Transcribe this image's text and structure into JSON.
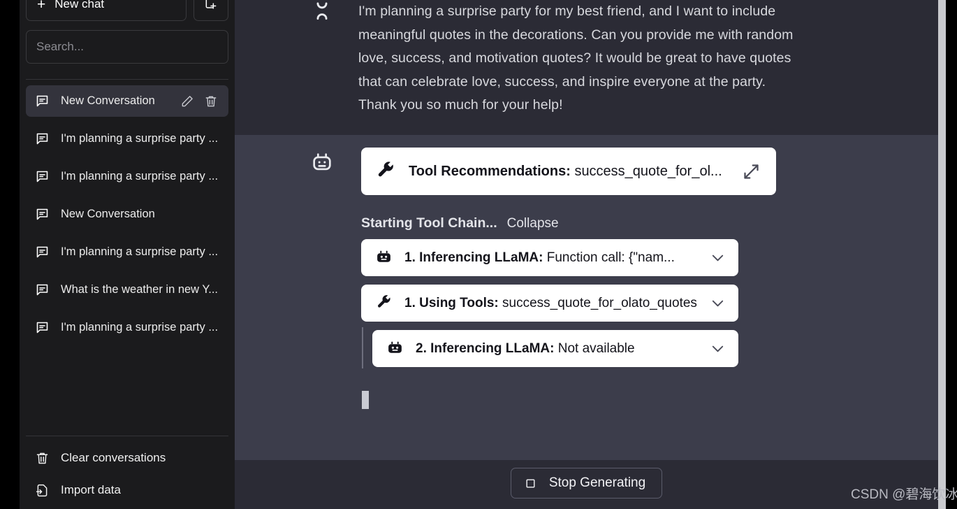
{
  "sidebar": {
    "new_chat_label": "New chat",
    "new_folder_icon": "new-folder-icon",
    "search_placeholder": "Search...",
    "search_value": "",
    "conversations": [
      {
        "label": "New Conversation",
        "icon": "chat-bubble-icon",
        "active": true
      },
      {
        "label": "I'm planning a surprise party ...",
        "icon": "chat-bubble-icon",
        "active": false
      },
      {
        "label": "I'm planning a surprise party ...",
        "icon": "chat-bubble-icon",
        "active": false
      },
      {
        "label": "New Conversation",
        "icon": "chat-bubble-icon",
        "active": false
      },
      {
        "label": "I'm planning a surprise party ...",
        "icon": "chat-bubble-icon",
        "active": false
      },
      {
        "label": "What is the weather in new Y...",
        "icon": "chat-bubble-icon",
        "active": false
      },
      {
        "label": "I'm planning a surprise party ...",
        "icon": "chat-bubble-icon",
        "active": false
      }
    ],
    "row_actions": {
      "edit_icon": "pencil-icon",
      "delete_icon": "trash-icon"
    },
    "clear_conversations_label": "Clear conversations",
    "import_data_label": "Import data"
  },
  "conversation": {
    "user_message": {
      "avatar_icon": "user-avatar-icon",
      "text": "I'm planning a surprise party for my best friend, and I want to include meaningful quotes in the decorations. Can you provide me with random love, success, and motivation quotes? It would be great to have quotes that can celebrate love, success, and inspire everyone at the party. Thank you so much for your help!"
    },
    "assistant_message": {
      "avatar_icon": "robot-icon",
      "tool_recommendations": {
        "icon": "wrench-icon",
        "label": "Tool Recommendations:",
        "value": "success_quote_for_ol...",
        "expand_icon": "expand-diagonal-icon"
      },
      "chain": {
        "title": "Starting Tool Chain...",
        "collapse_label": "Collapse",
        "steps": [
          {
            "icon": "robot-icon",
            "label": "1. Inferencing LLaMA:",
            "value": "Function call: {\"nam...",
            "chevron_icon": "chevron-down-icon",
            "nested": false
          },
          {
            "icon": "wrench-icon",
            "label": "1. Using Tools:",
            "value": "success_quote_for_olato_quotes",
            "chevron_icon": "chevron-down-icon",
            "nested": false
          },
          {
            "icon": "robot-icon",
            "label": "2. Inferencing LLaMA:",
            "value": "Not available",
            "chevron_icon": "chevron-down-icon",
            "nested": true
          }
        ]
      },
      "streaming_cursor": true
    }
  },
  "footer": {
    "stop_button_label": "Stop Generating",
    "stop_button_icon": "stop-square-icon"
  },
  "watermark": {
    "text": "CSDN @碧海饮冰"
  },
  "colors": {
    "gutter_black": "#000000",
    "sidebar_bg": "#1b1b1d",
    "sidebar_active": "#33333c",
    "user_msg_bg": "#2b2b35",
    "assistant_bg": "#3c3d4b",
    "card_bg": "#ffffff",
    "card_text": "#14141b",
    "scrollbar": "#c9cace"
  }
}
